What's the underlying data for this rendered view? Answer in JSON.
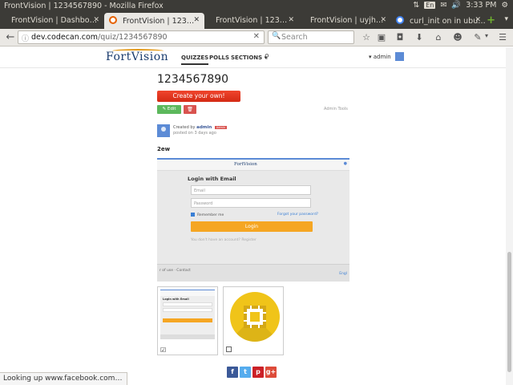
{
  "os": {
    "window_title": "FrontVision | 1234567890 - Mozilla Firefox",
    "keyboard": "En",
    "clock": "3:33 PM"
  },
  "tabs": [
    {
      "label": "FrontVision | Dashbo…",
      "active": false
    },
    {
      "label": "FrontVision | 123…",
      "active": true
    },
    {
      "label": "FrontVision | 123…",
      "active": false
    },
    {
      "label": "FrontVision | uyjh…",
      "active": false
    },
    {
      "label": "curl_init on in ubu…",
      "active": false
    }
  ],
  "url": {
    "host": "dev.codecan.com",
    "path": "/quiz/1234567890"
  },
  "search": {
    "placeholder": "Search"
  },
  "site": {
    "logo": "FortVision",
    "nav": [
      "QUIZZES",
      "POLLS",
      "SECTIONS ▾"
    ],
    "user": "admin"
  },
  "quiz": {
    "title": "1234567890",
    "create_label": "Create your own!",
    "edit_label": "Edit",
    "admin_tools": "Admin Tools",
    "created_by": "Created by",
    "author": "admin",
    "badge": "Admin",
    "posted": "posted on 3 days ago",
    "description": "2ew"
  },
  "embedded": {
    "logo": "FortVision",
    "heading": "Login with Email",
    "email_placeholder": "Email",
    "password_placeholder": "Password",
    "remember": "Remember me",
    "forgot": "Forgot your password?",
    "login": "Login",
    "register_prompt": "You don't have an account? Register",
    "footer_left": "r of use · Contact",
    "footer_right": "Engl"
  },
  "share": [
    "f",
    "t",
    "p",
    "g+"
  ],
  "share_colors": [
    "#3b5998",
    "#55acee",
    "#cb2027",
    "#dd4b39"
  ],
  "status": "Looking up www.facebook.com…"
}
